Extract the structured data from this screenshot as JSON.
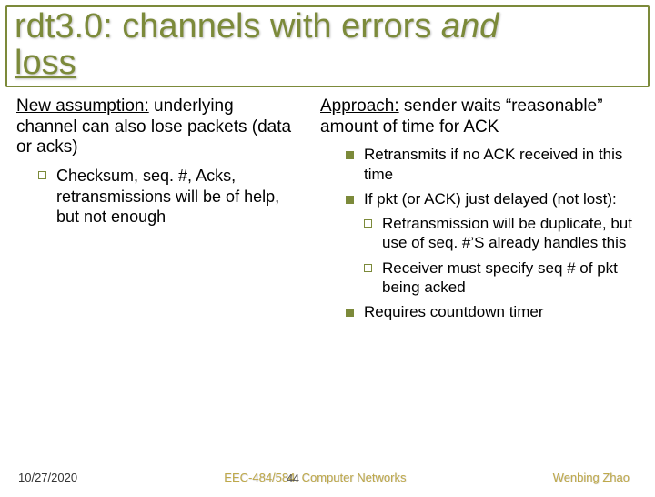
{
  "title": {
    "prefix": "rdt3.0: channels with errors ",
    "and": "and",
    "loss": "loss"
  },
  "left": {
    "assumption_label": "New assumption:",
    "assumption_text": " underlying channel can also lose packets (data or acks)",
    "sub1": "Checksum, seq. #, Acks, retransmissions will be of help, but not enough"
  },
  "right": {
    "approach_label": "Approach:",
    "approach_text": " sender waits “reasonable” amount of time for ACK",
    "b1": "Retransmits if no ACK received in this time",
    "b2": "If pkt (or ACK) just delayed (not lost):",
    "b2a": "Retransmission will be duplicate, but use of seq. #’S already handles this",
    "b2b": "Receiver must specify seq # of pkt being acked",
    "b3": "Requires countdown timer"
  },
  "footer": {
    "date": "10/27/2020",
    "center": "EEC-484/584: Computer Networks",
    "author": "Wenbing Zhao",
    "pageno": "44"
  }
}
